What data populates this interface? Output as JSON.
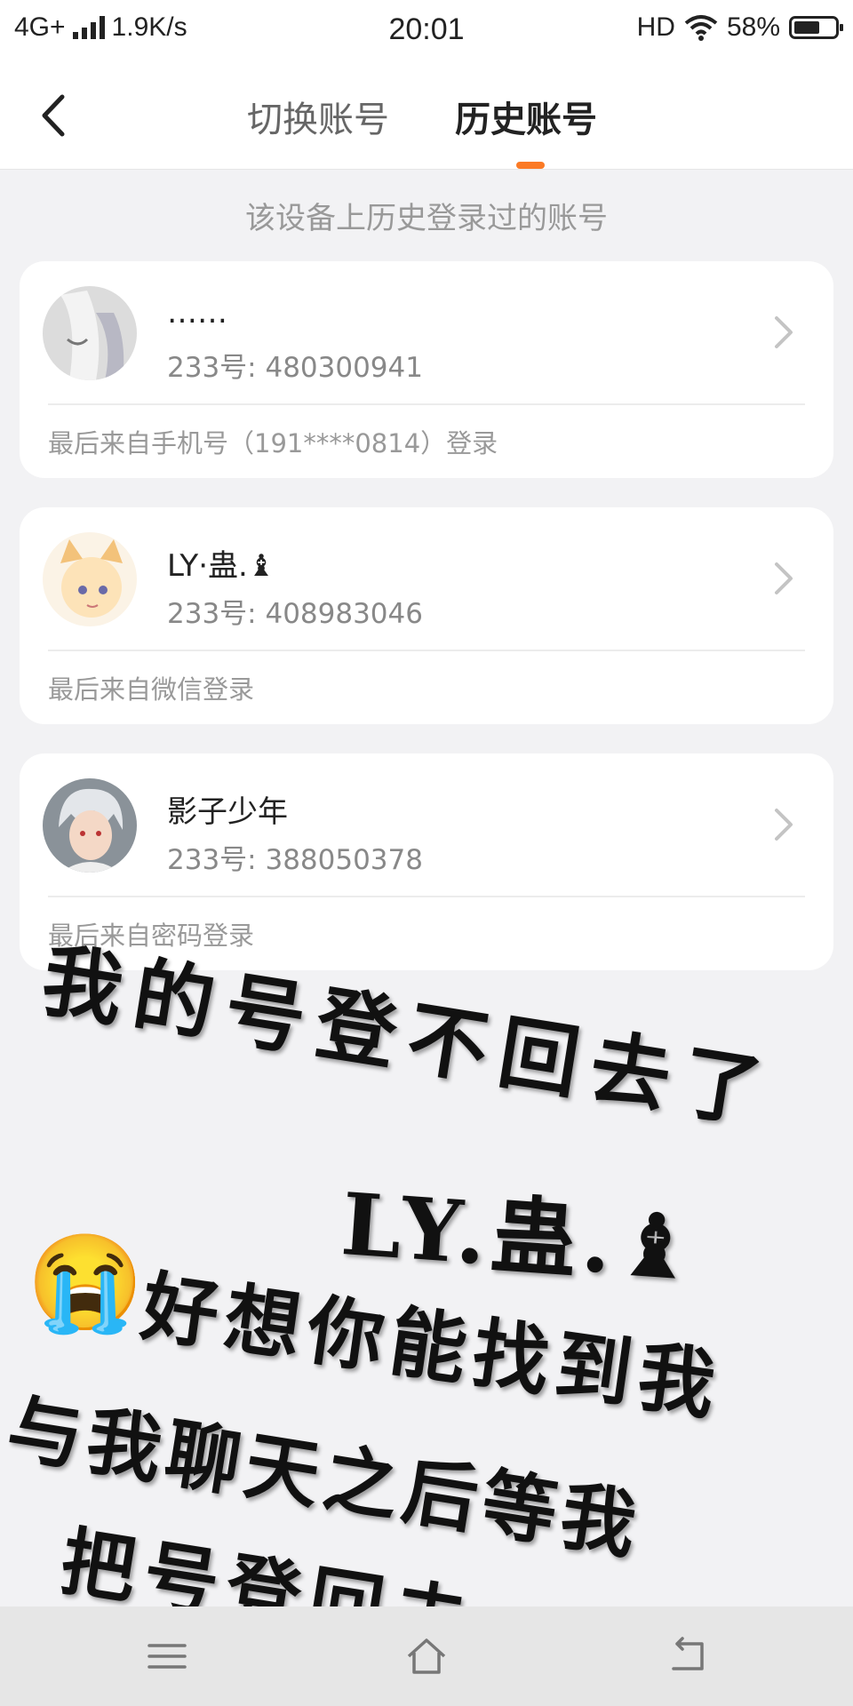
{
  "status_bar": {
    "network": "4G+",
    "speed": "1.9K/s",
    "time": "20:01",
    "hd": "HD",
    "battery": "58%",
    "battery_level": 0.58
  },
  "header": {
    "tabs": [
      {
        "label": "切换账号",
        "active": false
      },
      {
        "label": "历史账号",
        "active": true
      }
    ],
    "accent_color": "#fb7a25"
  },
  "subtitle": "该设备上历史登录过的账号",
  "accounts": [
    {
      "nickname": "……",
      "uid": "233号: 480300941",
      "last_login": "最后来自手机号（191****0814）登录"
    },
    {
      "nickname": "LY·蛊.♝",
      "uid": "233号: 408983046",
      "last_login": "最后来自微信登录"
    },
    {
      "nickname": "影子少年",
      "uid": "233号: 388050378",
      "last_login": "最后来自密码登录"
    }
  ],
  "overlay_text": {
    "line1": "我的号登不回去了",
    "line2": "LY.蛊.♝",
    "line3": "好想你能找到我",
    "line4": "与我聊天之后等我",
    "line5": "把号登回去。",
    "emoji": "😭"
  },
  "nav_bar": {
    "icons": [
      "menu-icon",
      "home-icon",
      "back-icon"
    ]
  }
}
